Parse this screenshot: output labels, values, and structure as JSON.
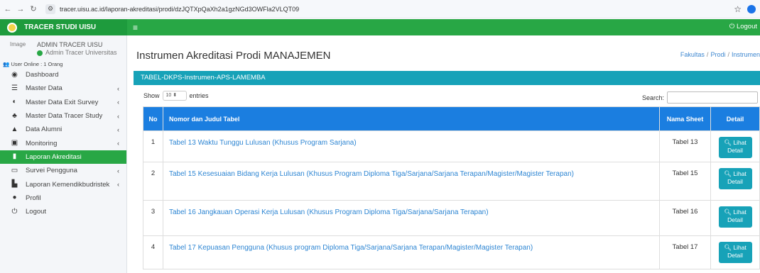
{
  "browser": {
    "url": "tracer.uisu.ac.id/laporan-akreditasi/prodi/dzJQTXpQaXh2a1gzNGd3OWFla2VLQT09"
  },
  "header": {
    "brand": "TRACER STUDI UISU",
    "logout": "Logout"
  },
  "user": {
    "avatar_alt": "Image",
    "name": "ADMIN TRACER UISU",
    "role": "Admin Tracer Universitas",
    "online": "User Online : 1 Orang"
  },
  "sidebar": {
    "items": [
      {
        "label": "Dashboard",
        "icon": "dashboard-icon",
        "caret": false
      },
      {
        "label": "Master Data",
        "icon": "database-icon",
        "caret": true
      },
      {
        "label": "Master Data Exit Survey",
        "icon": "handshake-icon",
        "caret": true
      },
      {
        "label": "Master Data Tracer Study",
        "icon": "people-icon",
        "caret": true
      },
      {
        "label": "Data Alumni",
        "icon": "graduation-cap-icon",
        "caret": true
      },
      {
        "label": "Monitoring",
        "icon": "monitor-icon",
        "caret": true
      },
      {
        "label": "Laporan Akreditasi",
        "icon": "chart-icon",
        "caret": false,
        "active": true
      },
      {
        "label": "Survei Pengguna",
        "icon": "laptop-icon",
        "caret": true
      },
      {
        "label": "Laporan Kemendikbudristek",
        "icon": "book-icon",
        "caret": true
      },
      {
        "label": "Profil",
        "icon": "user-icon",
        "caret": false
      },
      {
        "label": "Logout",
        "icon": "power-icon",
        "caret": false
      }
    ]
  },
  "main": {
    "title": "Instrumen Akreditasi Prodi MANAJEMEN",
    "breadcrumb": [
      "Fakultas",
      "Prodi",
      "Instrumen"
    ],
    "card_title": "TABEL-DKPS-Instrumen-APS-LAMEMBA",
    "show_label": "Show",
    "entries_value": "10",
    "entries_label": "entries",
    "search_label": "Search:",
    "search_value": ""
  },
  "table": {
    "headers": {
      "no": "No",
      "title": "Nomor dan Judul Tabel",
      "sheet": "Nama Sheet",
      "detail": "Detail"
    },
    "rows": [
      {
        "no": "1",
        "title": "Tabel 13 Waktu Tunggu Lulusan (Khusus Program Sarjana)",
        "sheet": "Tabel 13",
        "button": "Lihat Detail"
      },
      {
        "no": "2",
        "title": "Tabel 15 Kesesuaian Bidang Kerja Lulusan (Khusus Program Diploma Tiga/Sarjana/Sarjana Terapan/Magister/Magister Terapan)",
        "sheet": "Tabel 15",
        "button": "Lihat Detail"
      },
      {
        "no": "3",
        "title": "Tabel 16 Jangkauan Operasi Kerja Lulusan (Khusus Program Diploma Tiga/Sarjana/Sarjana Terapan)",
        "sheet": "Tabel 16",
        "button": "Lihat Detail"
      },
      {
        "no": "4",
        "title": "Tabel 17 Kepuasan Pengguna (Khusus program Diploma Tiga/Sarjana/Sarjana Terapan/Magister/Magister Terapan)",
        "sheet": "Tabel 17",
        "button": "Lihat Detail"
      }
    ]
  },
  "colors": {
    "brand_green": "#28a745",
    "header_teal": "#17a2b8",
    "table_header_blue": "#1b7ee0",
    "link_blue": "#2e86d3"
  }
}
